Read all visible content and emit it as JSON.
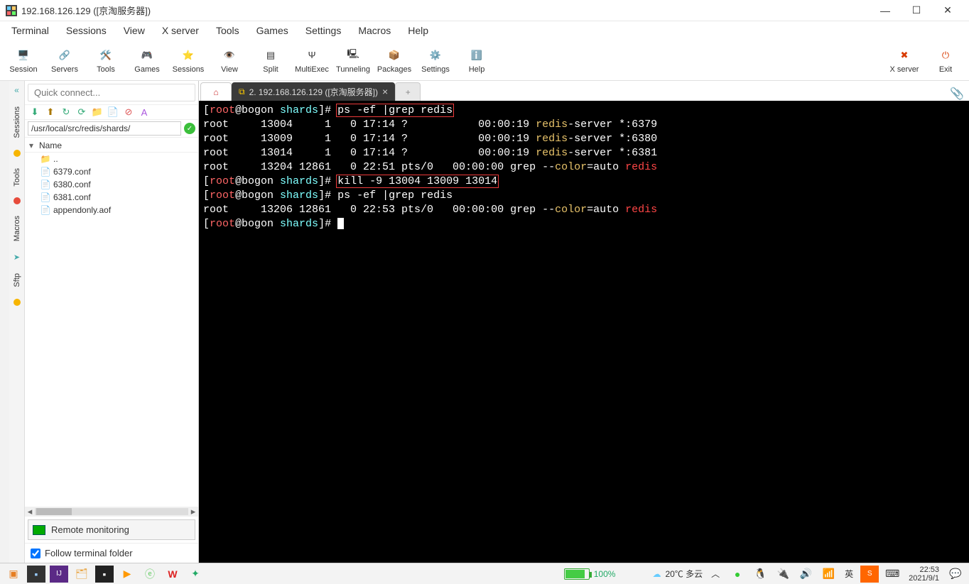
{
  "window": {
    "title": "192.168.126.129 ([京淘服务器])"
  },
  "menus": [
    "Terminal",
    "Sessions",
    "View",
    "X server",
    "Tools",
    "Games",
    "Settings",
    "Macros",
    "Help"
  ],
  "toolbar": [
    {
      "label": "Session",
      "icon": "🖥️"
    },
    {
      "label": "Servers",
      "icon": "🔗"
    },
    {
      "label": "Tools",
      "icon": "🛠️"
    },
    {
      "label": "Games",
      "icon": "🎮"
    },
    {
      "label": "Sessions",
      "icon": "⭐"
    },
    {
      "label": "View",
      "icon": "👁️"
    },
    {
      "label": "Split",
      "icon": "▤"
    },
    {
      "label": "MultiExec",
      "icon": "Ψ"
    },
    {
      "label": "Tunneling",
      "icon": "🖳"
    },
    {
      "label": "Packages",
      "icon": "📦"
    },
    {
      "label": "Settings",
      "icon": "⚙️"
    },
    {
      "label": "Help",
      "icon": "ℹ️"
    }
  ],
  "toolbar_right": [
    {
      "label": "X server",
      "icon": "✖",
      "color": "#d83b01"
    },
    {
      "label": "Exit",
      "icon": "⏻",
      "color": "#d83b01"
    }
  ],
  "quick_placeholder": "Quick connect...",
  "sftp": {
    "path": "/usr/local/src/redis/shards/",
    "name_header": "Name",
    "parent": "..",
    "files": [
      "6379.conf",
      "6380.conf",
      "6381.conf",
      "appendonly.aof"
    ],
    "remote_monitoring": "Remote monitoring",
    "follow": "Follow terminal folder"
  },
  "side_tabs": [
    "Sessions",
    "Tools",
    "Macros",
    "Sftp"
  ],
  "tabs": {
    "active_label": "2.  192.168.126.129  ([京淘服务器])"
  },
  "term": {
    "prompt": "[root@bogon shards]# ",
    "cmd1": "ps -ef |grep redis",
    "rows1": [
      {
        "user": "root",
        "pid": "13004",
        "ppid": "1",
        "c": "0",
        "stime": "17:14",
        "tty": "?",
        "time": "00:00:19",
        "svc": "redis",
        "rest": "-server *:6379"
      },
      {
        "user": "root",
        "pid": "13009",
        "ppid": "1",
        "c": "0",
        "stime": "17:14",
        "tty": "?",
        "time": "00:00:19",
        "svc": "redis",
        "rest": "-server *:6380"
      },
      {
        "user": "root",
        "pid": "13014",
        "ppid": "1",
        "c": "0",
        "stime": "17:14",
        "tty": "?",
        "time": "00:00:19",
        "svc": "redis",
        "rest": "-server *:6381"
      }
    ],
    "grep1": {
      "user": "root",
      "pid": "13204",
      "ppid": "12861",
      "c": "0",
      "stime": "22:51",
      "tty": "pts/0",
      "time": "00:00:00",
      "cmd_a": "grep --",
      "cmd_b": "color",
      "cmd_c": "=auto ",
      "cmd_d": "redis"
    },
    "cmd2": "kill -9 13004 13009 13014",
    "cmd3": "ps -ef |grep redis",
    "grep2": {
      "user": "root",
      "pid": "13206",
      "ppid": "12861",
      "c": "0",
      "stime": "22:53",
      "tty": "pts/0",
      "time": "00:00:00",
      "cmd_a": "grep --",
      "cmd_b": "color",
      "cmd_c": "=auto ",
      "cmd_d": "redis"
    }
  },
  "taskbar": {
    "battery_pct": "100%",
    "weather": "20℃ 多云",
    "ime": "英",
    "time": "22:53",
    "date": "2021/9/1"
  }
}
